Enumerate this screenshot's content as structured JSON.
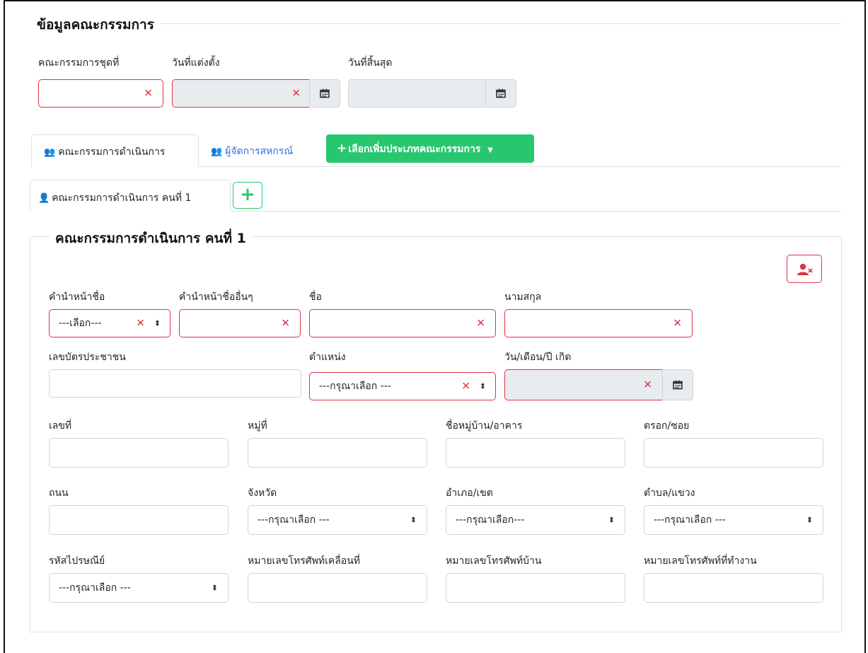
{
  "section": {
    "title": "ข้อมูลคณะกรรมการ",
    "board_set_label": "คณะกรรมการชุดที่",
    "appointed_date_label": "วันที่แต่งตั้ง",
    "end_date_label": "วันที่สิ้นสุด"
  },
  "tabs": {
    "board_exec": "คณะกรรมการดำเนินการ",
    "manager": "ผู้จัดการสหกรณ์",
    "add_type": "เลือกเพิ่มประเภทคณะกรรมการ"
  },
  "subtabs": {
    "member1": "คณะกรรมการดำเนินการ คนที่ 1",
    "add": "+"
  },
  "member": {
    "title": "คณะกรรมการดำเนินการ คนที่ 1",
    "prefix_label": "คำนำหน้าชื่อ",
    "prefix_value": "---เลือก---",
    "other_prefix_label": "คำนำหน้าชื่ออื่นๆ",
    "first_name_label": "ชื่อ",
    "last_name_label": "นามสกุล",
    "id_card_label": "เลขบัตรประชาชน",
    "position_label": "ตำแหน่ง",
    "position_value": "---กรุณาเลือก ---",
    "dob_label": "วัน/เดือน/ปี เกิด",
    "house_no_label": "เลขที่",
    "moo_label": "หมู่ที่",
    "village_label": "ชื่อหมู่บ้าน/อาคาร",
    "soi_label": "ตรอก/ซอย",
    "road_label": "ถนน",
    "province_label": "จังหวัด",
    "province_value": "---กรุณาเลือก ---",
    "district_label": "อำเภอ/เขต",
    "district_value": "---กรุณาเลือก---",
    "subdistrict_label": "ตำบล/แขวง",
    "subdistrict_value": "---กรุณาเลือก ---",
    "postcode_label": "รหัสไปรษณีย์",
    "postcode_value": "---กรุณาเลือก ---",
    "mobile_label": "หมายเลขโทรศัพท์เคลื่อนที่",
    "home_phone_label": "หมายเลขโทรศัพท์บ้าน",
    "work_phone_label": "หมายเลขโทรศัพท์ที่ทำงาน"
  },
  "colors": {
    "danger": "#dc3545",
    "success": "#28c76f",
    "primary": "#2f6fdd"
  }
}
